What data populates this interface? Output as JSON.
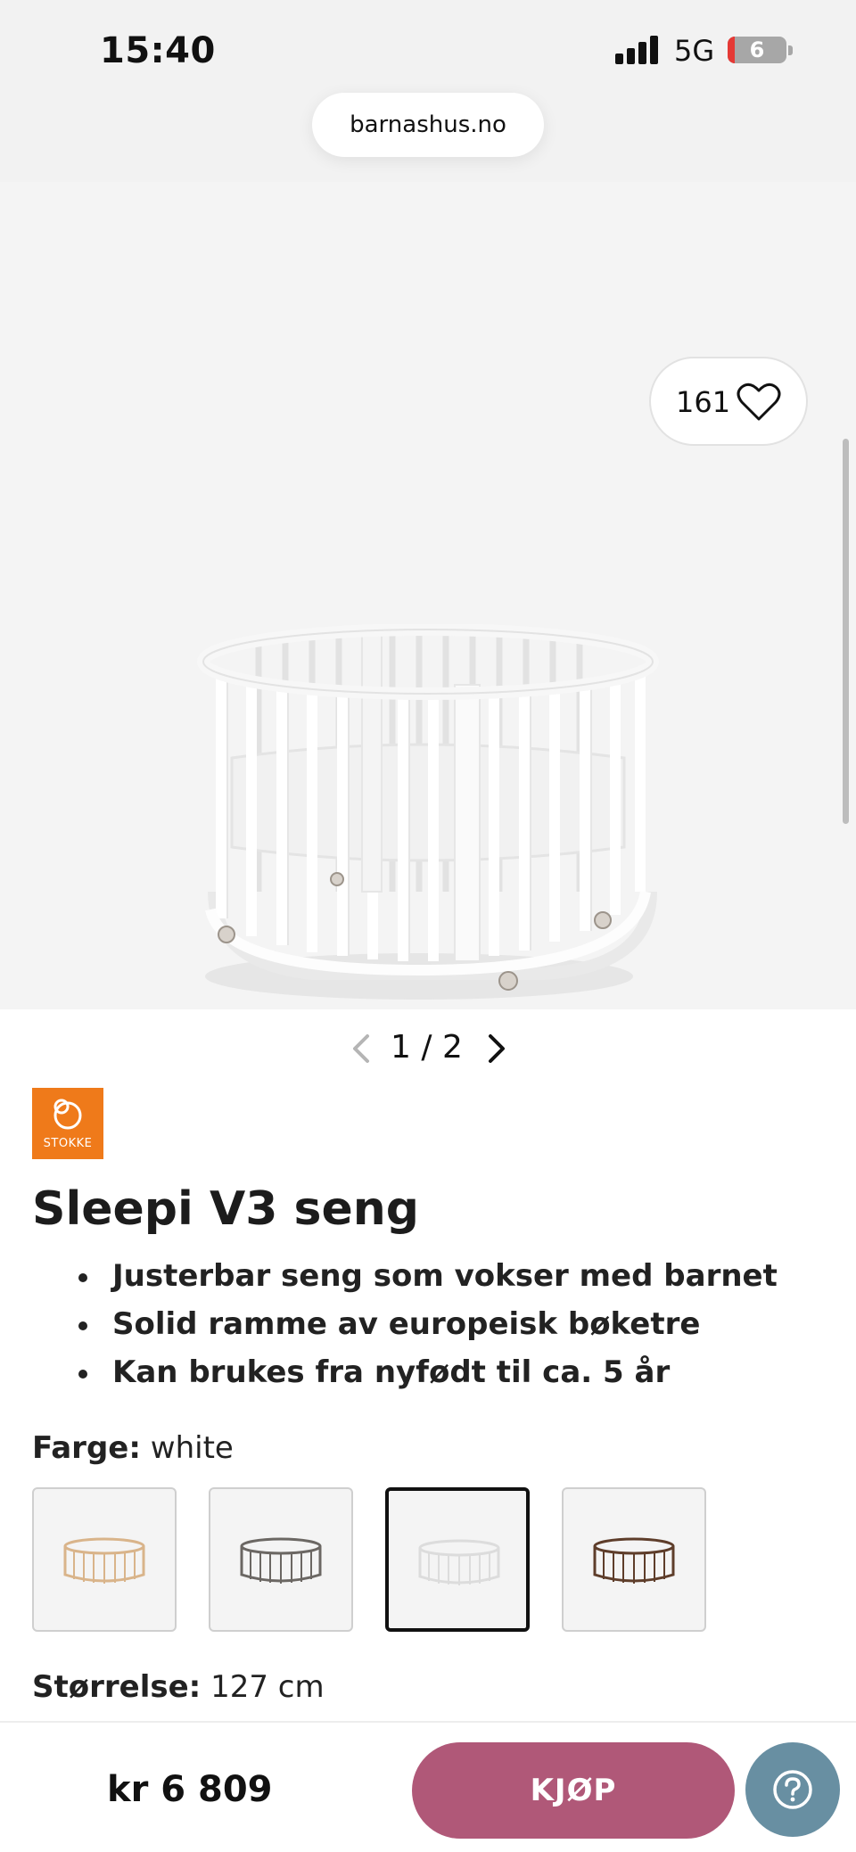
{
  "status_bar": {
    "time": "15:40",
    "network": "5G",
    "battery": "6"
  },
  "browser": {
    "url": "barnashus.no"
  },
  "product": {
    "favorites_count": "161",
    "pager": {
      "current": "1",
      "separator": "/",
      "total": "2"
    },
    "brand": "STOKKE",
    "title": "Sleepi V3 seng",
    "bullets": [
      "Justerbar seng som vokser med barnet",
      "Solid ramme av europeisk bøketre",
      "Kan brukes fra nyfødt til ca. 5 år"
    ],
    "color": {
      "label": "Farge:",
      "value": "white",
      "selected_index": 2,
      "options": [
        "natural",
        "grey",
        "white",
        "walnut"
      ]
    },
    "size": {
      "label": "Størrelse:",
      "value": "127 cm"
    }
  },
  "bottom_bar": {
    "price": "kr 6 809",
    "buy_label": "KJØP"
  },
  "colors": {
    "buy_button": "#b05878",
    "help_button": "#688fa2",
    "brand_logo": "#ef7a1a",
    "hero_background": "#f4f4f4"
  },
  "icons": {
    "favorite": "heart-icon",
    "previous": "chevron-left-icon",
    "next": "chevron-right-icon",
    "help": "question-icon"
  }
}
